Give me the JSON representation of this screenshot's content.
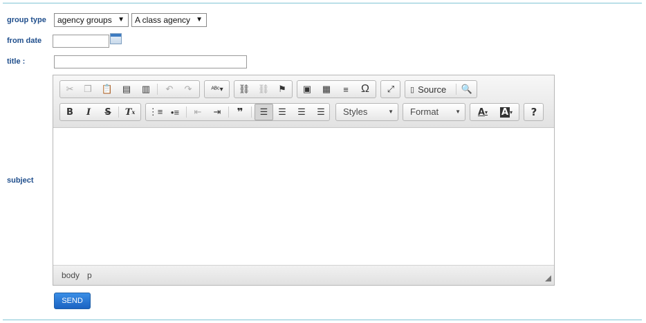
{
  "form": {
    "group_type_label": "group type",
    "group_type_value": "agency groups",
    "agency_class_value": "A class agency",
    "from_date_label": "from date",
    "from_date_value": "",
    "title_label": "title :",
    "title_value": "",
    "subject_label": "subject",
    "send_label": "SEND"
  },
  "editor": {
    "toolbar": {
      "source_label": "Source",
      "styles_label": "Styles",
      "format_label": "Format"
    },
    "content": "",
    "elements_path": [
      "body",
      "p"
    ]
  },
  "icons": [
    "cut-icon",
    "copy-icon",
    "paste-icon",
    "paste-text-icon",
    "paste-word-icon",
    "undo-icon",
    "redo-icon",
    "spellcheck-icon",
    "link-icon",
    "unlink-icon",
    "anchor-icon",
    "image-icon",
    "table-icon",
    "horizontal-rule-icon",
    "special-char-icon",
    "maximize-icon",
    "source-icon",
    "preview-icon",
    "bold-icon",
    "italic-icon",
    "strike-icon",
    "remove-format-icon",
    "numbered-list-icon",
    "bulleted-list-icon",
    "outdent-icon",
    "indent-icon",
    "blockquote-icon",
    "align-left-icon",
    "align-center-icon",
    "align-right-icon",
    "justify-icon",
    "text-color-icon",
    "background-color-icon",
    "help-icon",
    "calendar-icon"
  ]
}
